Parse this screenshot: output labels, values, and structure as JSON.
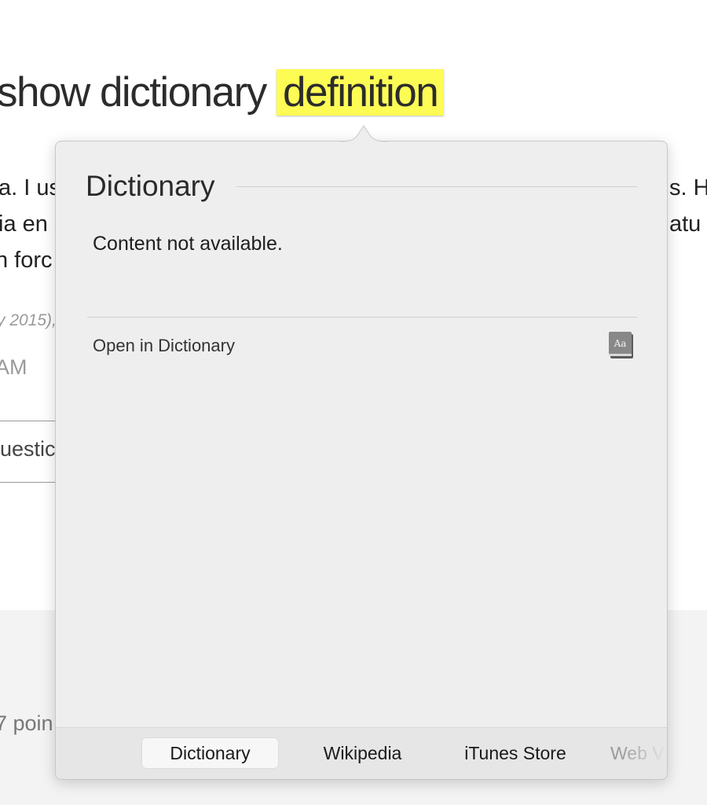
{
  "article": {
    "heading_prefix": "show dictionary",
    "heading_highlight": "definition",
    "body_lines": [
      {
        "left": "a. I us",
        "right": "s. H"
      },
      {
        "left": "ia en",
        "right": "atu"
      },
      {
        "left": "n forc",
        "right": ""
      }
    ],
    "date_fragment": "y 2015),",
    "time_fragment": "AM",
    "answer_fragment": "uestic",
    "points_fragment": "7 poin"
  },
  "popover": {
    "title": "Dictionary",
    "message": "Content not available.",
    "open_link": "Open in Dictionary",
    "dict_icon_glyph": "Aa",
    "tabs": [
      {
        "label": "Dictionary",
        "active": true
      },
      {
        "label": "Wikipedia",
        "active": false
      },
      {
        "label": "iTunes Store",
        "active": false
      },
      {
        "label": "Web V",
        "active": false
      }
    ]
  },
  "colors": {
    "highlight": "#fdfc55",
    "popover_bg": "#eeeeee",
    "tabbar_bg": "#e6e6e6"
  }
}
